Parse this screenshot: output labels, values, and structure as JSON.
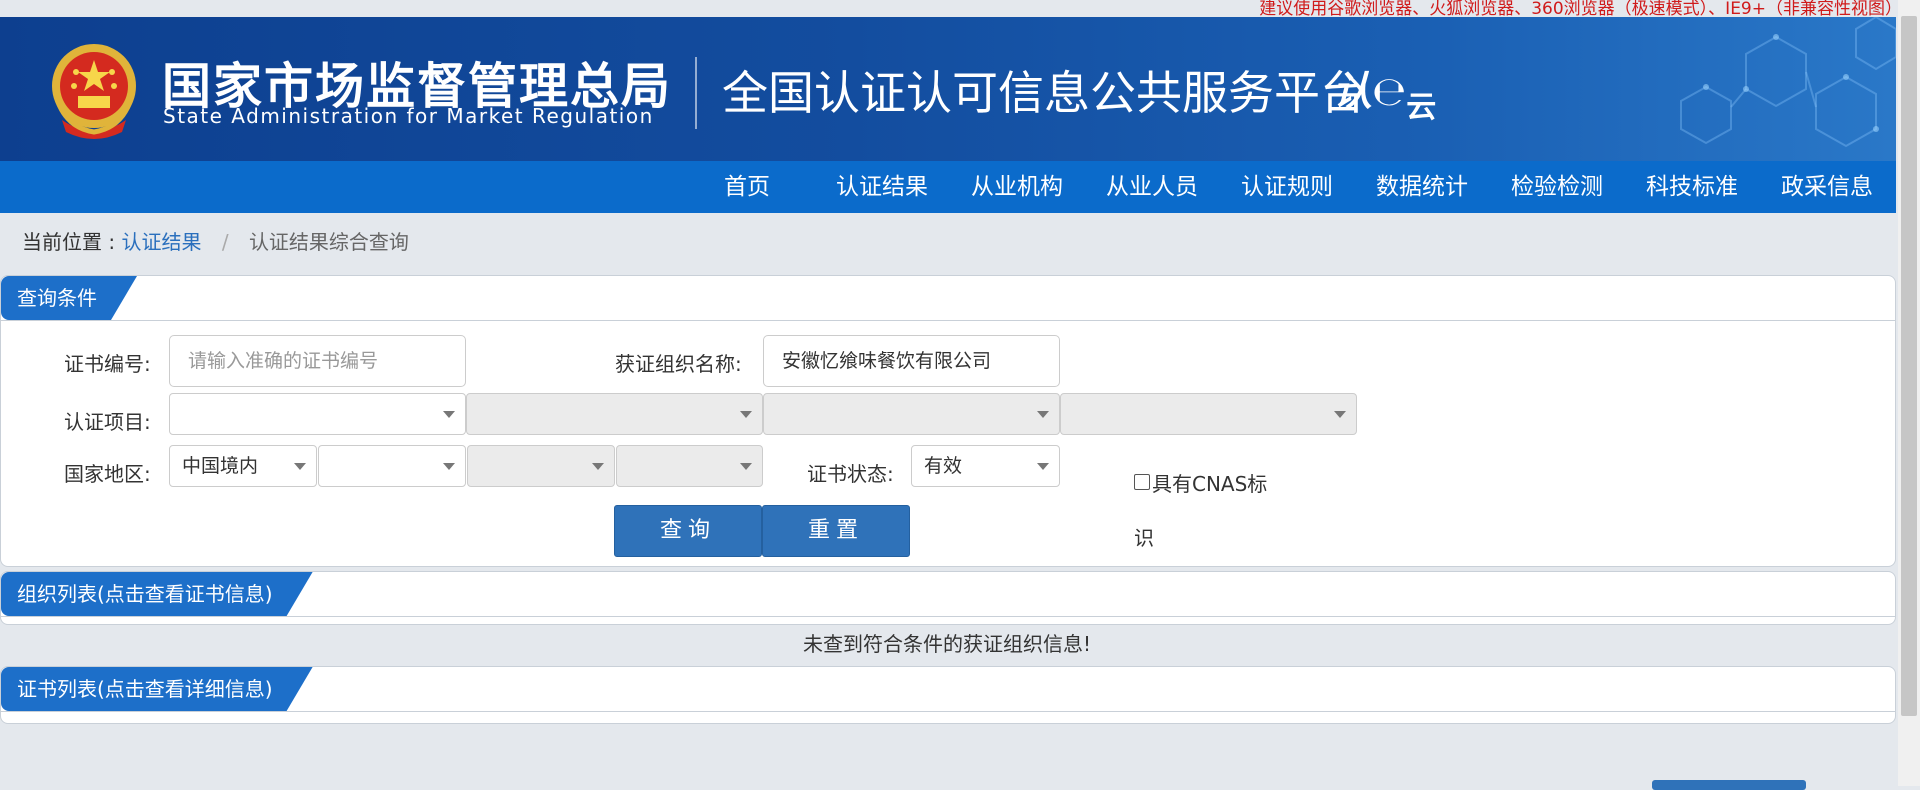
{
  "top_notice": "建议使用谷歌浏览器、火狐浏览器、360浏览器（极速模式）、IE9+（非兼容性视图）",
  "header": {
    "agency_cn": "国家市场监督管理总局",
    "agency_en": "State Administration  for  Market Regulation",
    "platform_title": "全国认证认可信息公共服务平台",
    "cloud_logo_main": "认",
    "cloud_logo_sub": "云",
    "emblem_icon": "national-emblem-icon"
  },
  "nav": {
    "items": [
      "首页",
      "认证结果",
      "从业机构",
      "从业人员",
      "认证规则",
      "数据统计",
      "检验检测",
      "科技标准",
      "政采信息"
    ]
  },
  "breadcrumb": {
    "prefix": "当前位置 :",
    "link": "认证结果",
    "separator": "/",
    "current": "认证结果综合查询"
  },
  "query_panel": {
    "title": "查询条件",
    "cert_no_label": "证书编号:",
    "cert_no_placeholder": "请输入准确的证书编号",
    "org_name_label": "获证组织名称:",
    "org_name_value": "安徽忆飨味餐饮有限公司",
    "project_label": "认证项目:",
    "project_selects": [
      "",
      "",
      "",
      ""
    ],
    "region_label": "国家地区:",
    "region_selects": [
      "中国境内",
      "",
      "",
      ""
    ],
    "status_label": "证书状态:",
    "status_value": "有效",
    "cnas_label_line1": "具有CNAS标",
    "cnas_label_line2": "识",
    "cnas_checked": false,
    "query_button": "查询",
    "reset_button": "重置"
  },
  "org_list": {
    "title": "组织列表(点击查看证书信息)",
    "empty_message": "未查到符合条件的获证组织信息!"
  },
  "cert_list": {
    "title": "证书列表(点击查看详细信息)"
  },
  "colors": {
    "nav_blue": "#0b6bcb",
    "panel_head_blue": "#1d6fc9",
    "button_blue": "#2f72b9",
    "notice_red": "#d01b1b",
    "link_blue": "#2a6fbd"
  }
}
